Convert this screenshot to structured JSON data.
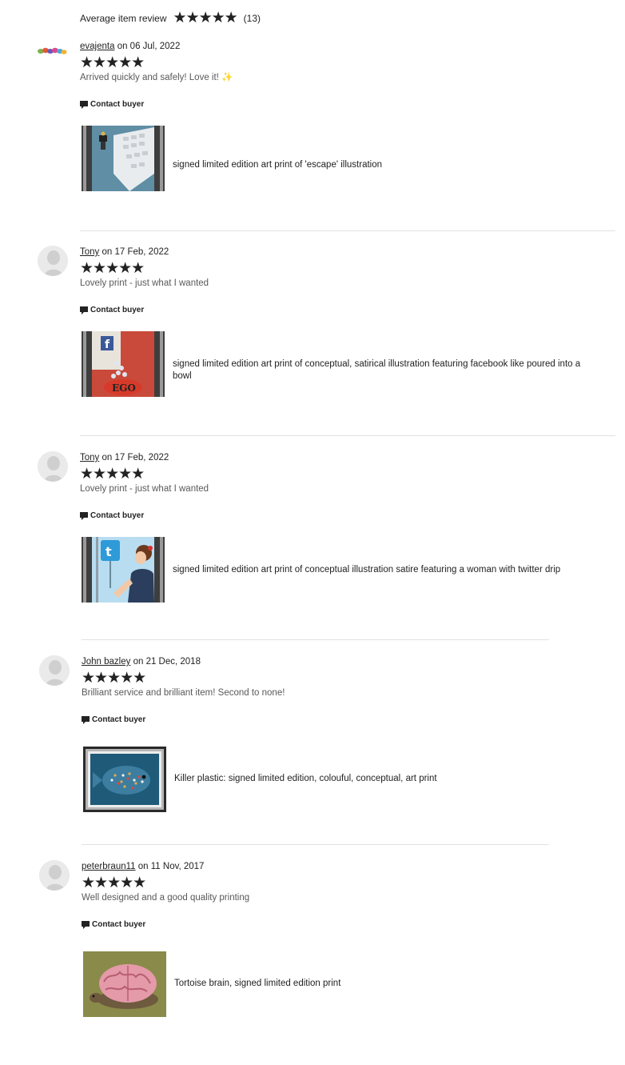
{
  "summary": {
    "label": "Average item review",
    "stars": "★★★★★",
    "count": "(13)"
  },
  "reviews": [
    {
      "user": "evajenta",
      "date_text": "on 06 Jul, 2022",
      "stars": "★★★★★",
      "text": "Arrived quickly and safely! Love it! ✨",
      "contact": "Contact buyer",
      "product": "signed limited edition art print of 'escape' illustration"
    },
    {
      "user": "Tony",
      "date_text": "on 17 Feb, 2022",
      "stars": "★★★★★",
      "text": "Lovely print - just what I wanted",
      "contact": "Contact buyer",
      "product": "signed limited edition art print of conceptual, satirical illustration featuring facebook like poured into a bowl"
    },
    {
      "user": "Tony",
      "date_text": "on 17 Feb, 2022",
      "stars": "★★★★★",
      "text": "Lovely print - just what I wanted",
      "contact": "Contact buyer",
      "product": "signed limited edition art print of conceptual illustration satire featuring a woman with twitter drip"
    },
    {
      "user": "John bazley",
      "date_text": "on 21 Dec, 2018",
      "stars": "★★★★★",
      "text": "Brilliant service and brilliant item! Second to none!",
      "contact": "Contact buyer",
      "product": "Killer plastic: signed limited edition, colouful, conceptual, art print"
    },
    {
      "user": "peterbraun11",
      "date_text": "on 11 Nov, 2017",
      "stars": "★★★★★",
      "text": "Well designed and a good quality printing",
      "contact": "Contact buyer",
      "product": "Tortoise brain, signed limited edition print"
    }
  ],
  "thumb_text": {
    "ego": "EGO"
  }
}
